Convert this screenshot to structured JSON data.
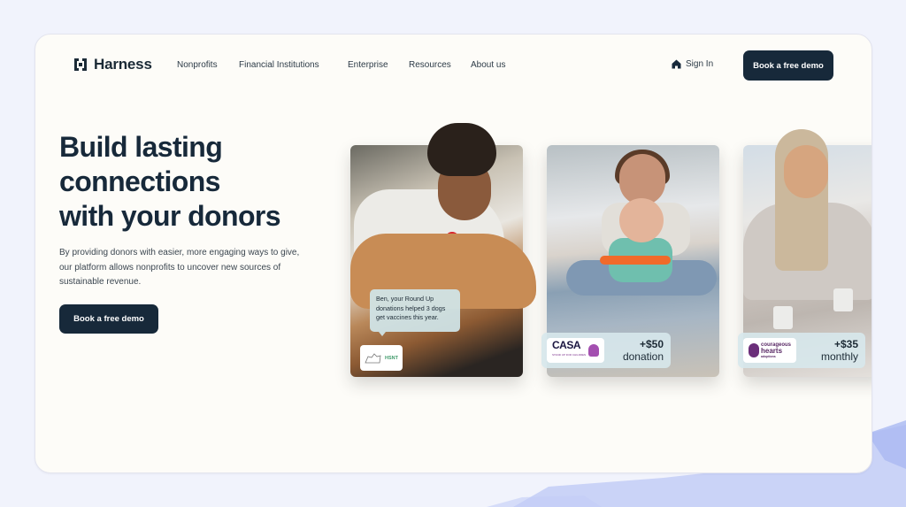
{
  "header": {
    "brand": "Harness",
    "nav": [
      "Nonprofits",
      "Financial Institutions",
      "Enterprise",
      "Resources",
      "About us"
    ],
    "sign_in": "Sign In",
    "cta": "Book a free demo"
  },
  "hero": {
    "headline_lines": [
      "Build lasting",
      "connections",
      "with your donors"
    ],
    "description": "By providing donors with easier, more engaging ways to give, our platform allows nonprofits to uncover new sources of sustainable revenue.",
    "cta": "Book a free demo"
  },
  "cards": [
    {
      "message": "Ben, your Round Up donations helped 3 dogs get vaccines this year.",
      "org_logo": "HSNT"
    },
    {
      "org_logo": "CASA",
      "org_tagline": "STAND UP FOR CHILDREN",
      "amount": "+$50",
      "type": "donation"
    },
    {
      "org_logo_lines": [
        "courageous",
        "hearts",
        "adoptions"
      ],
      "amount": "+$35",
      "type": "monthly"
    }
  ],
  "colors": {
    "primary": "#17293a",
    "page_bg": "#f1f3fc",
    "card_bg": "#fdfcf8",
    "brush": "#b8c4f3"
  }
}
